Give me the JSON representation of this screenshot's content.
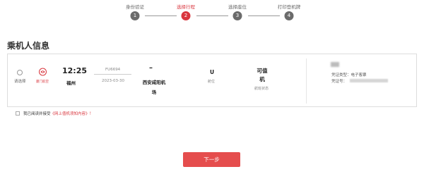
{
  "steps": [
    {
      "number": "1",
      "label": "身份验证",
      "active": false
    },
    {
      "number": "2",
      "label": "选择行程",
      "active": true
    },
    {
      "number": "3",
      "label": "选择座位",
      "active": false
    },
    {
      "number": "4",
      "label": "打印登机牌",
      "active": false
    }
  ],
  "section_title": "乘机人信息",
  "flight": {
    "select_label": "请选择",
    "airline_name": "厦门航空",
    "departure_time": "12:25",
    "departure_city": "福州",
    "flight_number": "FU6694",
    "date": "2023-03-30",
    "arrival_time": "–",
    "arrival_city_line1": "西安咸阳机",
    "arrival_city_line2": "场",
    "cabin": "U",
    "cabin_label": "舱位",
    "status_line1": "可值",
    "status_line2": "机",
    "status_label": "航班状态"
  },
  "passenger": {
    "doc_type_label": "凭证类型：",
    "doc_type_value": "电子客票",
    "doc_no_label": "凭证号："
  },
  "agreement": {
    "text": "我已阅读并接受",
    "link": "《网上值机须知内容》",
    "suffix": "！"
  },
  "next_button": "下一步",
  "colors": {
    "accent": "#d9363e",
    "button": "#e54d4d",
    "inactive_step": "#6b6b6b"
  }
}
